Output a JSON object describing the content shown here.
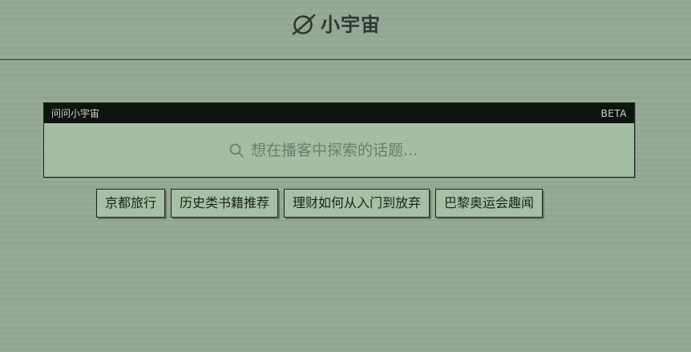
{
  "header": {
    "logo_icon": "planet-icon",
    "logo_text": "小宇宙"
  },
  "ask": {
    "title": "问问小宇宙",
    "badge": "BETA",
    "search_icon": "search-icon",
    "placeholder": "想在播客中探索的话题..."
  },
  "suggestions": [
    {
      "label": "京都旅行"
    },
    {
      "label": "历史类书籍推荐"
    },
    {
      "label": "理财如何从入门到放弃"
    },
    {
      "label": "巴黎奥运会趣闻"
    }
  ],
  "colors": {
    "background": "#94a894",
    "panel": "#a3bfa3",
    "titlebar": "#0f1410",
    "ink": "#2a3a2d"
  }
}
